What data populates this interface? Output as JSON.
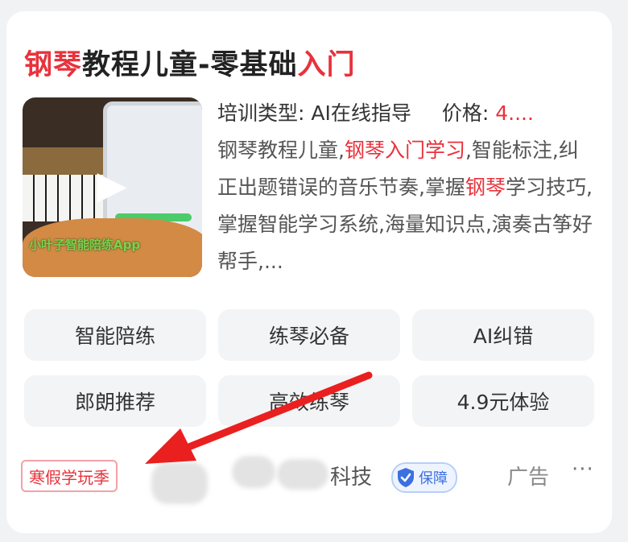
{
  "card": {
    "title": {
      "prefix": "钢琴",
      "middle": "教程儿童-零基础",
      "suffix": "入门"
    },
    "thumbnail": {
      "watermark": "小叶子智能陪练App",
      "play_icon": "play-icon"
    },
    "info": {
      "type_label": "培训类型: AI在线指导",
      "price_label": "价格: ",
      "price_value": "4...."
    },
    "description": {
      "part1": "钢琴教程儿童,",
      "highlight1": "钢琴入门学习",
      "part2": ",智能标注,纠正出题错误的音乐节奏,掌握",
      "highlight2": "钢琴",
      "part3": "学习技巧,掌握智能学习系统,海量知识点,演奏古筝好帮手,..."
    },
    "tags": [
      "智能陪练",
      "练琴必备",
      "AI纠错",
      "郎朗推荐",
      "高效练琴",
      "4.9元体验"
    ],
    "footer": {
      "badge": "寒假学玩季",
      "company_suffix": "科技",
      "guarantee": "保障",
      "ad": "广告",
      "more": "···"
    }
  },
  "colors": {
    "accent_red": "#e8323c",
    "guarantee_blue": "#3c6fe0",
    "card_bg": "#ffffff",
    "page_bg": "#f1f2f4"
  }
}
